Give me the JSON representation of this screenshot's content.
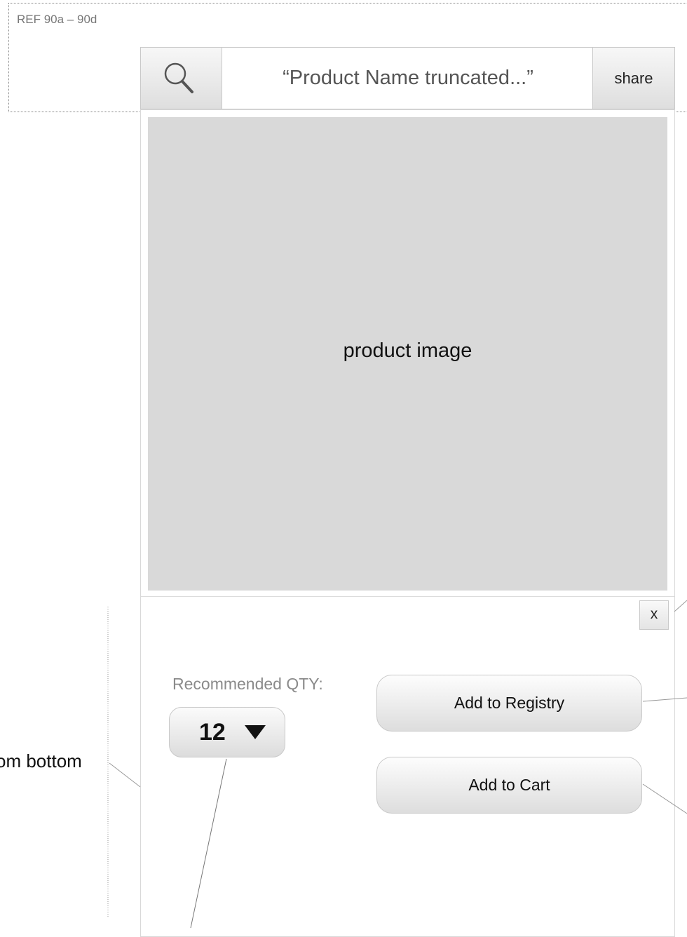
{
  "ref": {
    "label": "REF 90a – 90d"
  },
  "header": {
    "title": "“Product Name truncated...”",
    "share_label": "share"
  },
  "product": {
    "image_label": "product image"
  },
  "popup": {
    "close_label": "x",
    "qty_label": "Recommended QTY:",
    "qty_value": "12",
    "add_registry_label": "Add to Registry",
    "add_cart_label": "Add to Cart"
  },
  "annotations": {
    "left_text": "om bottom"
  }
}
